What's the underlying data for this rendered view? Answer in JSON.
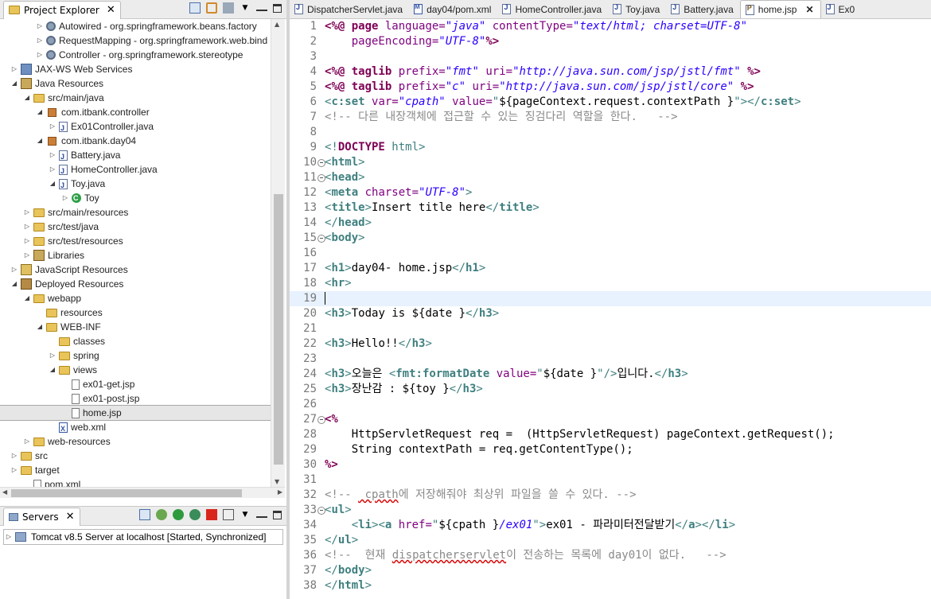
{
  "explorer": {
    "title": "Project Explorer",
    "close": "✕",
    "items": [
      {
        "indent": 3,
        "twisty": "▷",
        "icon": "gear",
        "label": "Autowired - org.springframework.beans.factory"
      },
      {
        "indent": 3,
        "twisty": "▷",
        "icon": "gear",
        "label": "RequestMapping - org.springframework.web.bind"
      },
      {
        "indent": 3,
        "twisty": "▷",
        "icon": "gear",
        "label": "Controller - org.springframework.stereotype"
      },
      {
        "indent": 1,
        "twisty": "▷",
        "icon": "jax",
        "label": "JAX-WS Web Services"
      },
      {
        "indent": 1,
        "twisty": "◢",
        "icon": "lib",
        "label": "Java Resources"
      },
      {
        "indent": 2,
        "twisty": "◢",
        "icon": "folder",
        "label": "src/main/java"
      },
      {
        "indent": 3,
        "twisty": "◢",
        "icon": "pkg",
        "label": "com.itbank.controller"
      },
      {
        "indent": 4,
        "twisty": "▷",
        "icon": "java",
        "label": "Ex01Controller.java"
      },
      {
        "indent": 3,
        "twisty": "◢",
        "icon": "pkg",
        "label": "com.itbank.day04"
      },
      {
        "indent": 4,
        "twisty": "▷",
        "icon": "java",
        "label": "Battery.java"
      },
      {
        "indent": 4,
        "twisty": "▷",
        "icon": "java",
        "label": "HomeController.java"
      },
      {
        "indent": 4,
        "twisty": "◢",
        "icon": "java",
        "label": "Toy.java"
      },
      {
        "indent": 5,
        "twisty": "▷",
        "icon": "cls",
        "label": "Toy"
      },
      {
        "indent": 2,
        "twisty": "▷",
        "icon": "folder",
        "label": "src/main/resources"
      },
      {
        "indent": 2,
        "twisty": "▷",
        "icon": "folder",
        "label": "src/test/java"
      },
      {
        "indent": 2,
        "twisty": "▷",
        "icon": "folder",
        "label": "src/test/resources"
      },
      {
        "indent": 2,
        "twisty": "▷",
        "icon": "lib",
        "label": "Libraries"
      },
      {
        "indent": 1,
        "twisty": "▷",
        "icon": "js",
        "label": "JavaScript Resources"
      },
      {
        "indent": 1,
        "twisty": "◢",
        "icon": "dep",
        "label": "Deployed Resources"
      },
      {
        "indent": 2,
        "twisty": "◢",
        "icon": "folder",
        "label": "webapp"
      },
      {
        "indent": 3,
        "twisty": "",
        "icon": "folder",
        "label": "resources"
      },
      {
        "indent": 3,
        "twisty": "◢",
        "icon": "folder",
        "label": "WEB-INF"
      },
      {
        "indent": 4,
        "twisty": "",
        "icon": "folder",
        "label": "classes"
      },
      {
        "indent": 4,
        "twisty": "▷",
        "icon": "folder",
        "label": "spring"
      },
      {
        "indent": 4,
        "twisty": "◢",
        "icon": "folder",
        "label": "views"
      },
      {
        "indent": 5,
        "twisty": "",
        "icon": "file",
        "label": "ex01-get.jsp"
      },
      {
        "indent": 5,
        "twisty": "",
        "icon": "file",
        "label": "ex01-post.jsp"
      },
      {
        "indent": 5,
        "twisty": "",
        "icon": "file",
        "label": "home.jsp",
        "selected": true
      },
      {
        "indent": 4,
        "twisty": "",
        "icon": "xml",
        "label": "web.xml"
      },
      {
        "indent": 2,
        "twisty": "▷",
        "icon": "folder",
        "label": "web-resources"
      },
      {
        "indent": 1,
        "twisty": "▷",
        "icon": "folder",
        "label": "src"
      },
      {
        "indent": 1,
        "twisty": "▷",
        "icon": "folder",
        "label": "target"
      },
      {
        "indent": 2,
        "twisty": "",
        "icon": "file",
        "label": "pom.xml"
      }
    ]
  },
  "servers": {
    "title": "Servers",
    "close": "✕",
    "row": "Tomcat v8.5 Server at localhost  [Started, Synchronized]"
  },
  "editor": {
    "tabs": [
      {
        "label": "DispatcherServlet.java",
        "icon": "j"
      },
      {
        "label": "day04/pom.xml",
        "icon": "m"
      },
      {
        "label": "HomeController.java",
        "icon": "j"
      },
      {
        "label": "Toy.java",
        "icon": "j"
      },
      {
        "label": "Battery.java",
        "icon": "j"
      },
      {
        "label": "home.jsp",
        "icon": "p",
        "active": true
      },
      {
        "label": "Ex0",
        "icon": "j"
      }
    ],
    "active_close": "✕",
    "current_line": 19,
    "colors": {
      "keyword": "#7f0055",
      "directive": "#7f0055",
      "string": "#2a00ff",
      "italic_string": "#2a00ff",
      "tag": "#3f7f7f",
      "tagname": "#3f7f7f",
      "attr": "#7f007f",
      "attrval": "#2a00ff",
      "comment": "#3f5fbf",
      "gray": "#8a8a8a",
      "el": "#000000",
      "text": "#000000"
    }
  },
  "code": [
    {
      "n": 1,
      "fold": false,
      "segs": [
        [
          "<%@ ",
          "d"
        ],
        [
          "page ",
          "k"
        ],
        [
          "language=",
          "a"
        ],
        [
          "\"java\"",
          "v"
        ],
        [
          " contentType=",
          "a"
        ],
        [
          "\"text/html; charset=UTF-8\"",
          "v"
        ]
      ]
    },
    {
      "n": 2,
      "fold": false,
      "segs": [
        [
          "    pageEncoding=",
          "a"
        ],
        [
          "\"UTF-8\"",
          "v"
        ],
        [
          "%>",
          "d"
        ]
      ]
    },
    {
      "n": 3,
      "fold": false,
      "segs": []
    },
    {
      "n": 4,
      "fold": false,
      "segs": [
        [
          "<%@ ",
          "d"
        ],
        [
          "taglib ",
          "k"
        ],
        [
          "prefix=",
          "a"
        ],
        [
          "\"fmt\"",
          "v"
        ],
        [
          " uri=",
          "a"
        ],
        [
          "\"http://java.sun.com/jsp/jstl/fmt\"",
          "v"
        ],
        [
          " %>",
          "d"
        ]
      ]
    },
    {
      "n": 5,
      "fold": false,
      "segs": [
        [
          "<%@ ",
          "d"
        ],
        [
          "taglib ",
          "k"
        ],
        [
          "prefix=",
          "a"
        ],
        [
          "\"c\"",
          "v"
        ],
        [
          " uri=",
          "a"
        ],
        [
          "\"http://java.sun.com/jsp/jstl/core\"",
          "v"
        ],
        [
          " %>",
          "d"
        ]
      ]
    },
    {
      "n": 6,
      "fold": false,
      "segs": [
        [
          "<",
          "t"
        ],
        [
          "c:set ",
          "tk"
        ],
        [
          "var=",
          "a"
        ],
        [
          "\"cpath\"",
          "v"
        ],
        [
          " value=",
          "a"
        ],
        [
          "\"",
          "t"
        ],
        [
          "${pageContext.request.contextPath }",
          "e"
        ],
        [
          "\"></",
          "t"
        ],
        [
          "c:set",
          "tk"
        ],
        [
          ">",
          "t"
        ]
      ]
    },
    {
      "n": 7,
      "fold": false,
      "segs": [
        [
          "<!-- ",
          "g"
        ],
        [
          "다른 내장객체에 접근할 수 있는 징검다리 역할을 한다.   -->",
          "g"
        ]
      ]
    },
    {
      "n": 8,
      "fold": false,
      "segs": []
    },
    {
      "n": 9,
      "fold": false,
      "segs": [
        [
          "<!",
          "t"
        ],
        [
          "DOCTYPE ",
          "dk"
        ],
        [
          "html",
          "h"
        ],
        [
          ">",
          "t"
        ]
      ]
    },
    {
      "n": 10,
      "fold": true,
      "segs": [
        [
          "<",
          "t"
        ],
        [
          "html",
          "tk"
        ],
        [
          ">",
          "t"
        ]
      ]
    },
    {
      "n": 11,
      "fold": true,
      "segs": [
        [
          "<",
          "t"
        ],
        [
          "head",
          "tk"
        ],
        [
          ">",
          "t"
        ]
      ]
    },
    {
      "n": 12,
      "fold": false,
      "segs": [
        [
          "<",
          "t"
        ],
        [
          "meta ",
          "tk"
        ],
        [
          "charset=",
          "a"
        ],
        [
          "\"UTF-8\"",
          "v"
        ],
        [
          ">",
          "t"
        ]
      ]
    },
    {
      "n": 13,
      "fold": false,
      "segs": [
        [
          "<",
          "t"
        ],
        [
          "title",
          "tk"
        ],
        [
          ">",
          "t"
        ],
        [
          "Insert title here",
          "x"
        ],
        [
          "</",
          "t"
        ],
        [
          "title",
          "tk"
        ],
        [
          ">",
          "t"
        ]
      ]
    },
    {
      "n": 14,
      "fold": false,
      "segs": [
        [
          "</",
          "t"
        ],
        [
          "head",
          "tk"
        ],
        [
          ">",
          "t"
        ]
      ]
    },
    {
      "n": 15,
      "fold": true,
      "segs": [
        [
          "<",
          "t"
        ],
        [
          "body",
          "tk"
        ],
        [
          ">",
          "t"
        ]
      ]
    },
    {
      "n": 16,
      "fold": false,
      "segs": []
    },
    {
      "n": 17,
      "fold": false,
      "segs": [
        [
          "<",
          "t"
        ],
        [
          "h1",
          "tk"
        ],
        [
          ">",
          "t"
        ],
        [
          "day04- home.jsp",
          "x"
        ],
        [
          "</",
          "t"
        ],
        [
          "h1",
          "tk"
        ],
        [
          ">",
          "t"
        ]
      ]
    },
    {
      "n": 18,
      "fold": false,
      "segs": [
        [
          "<",
          "t"
        ],
        [
          "hr",
          "tk"
        ],
        [
          ">",
          "t"
        ]
      ]
    },
    {
      "n": 19,
      "fold": false,
      "segs": []
    },
    {
      "n": 20,
      "fold": false,
      "segs": [
        [
          "<",
          "t"
        ],
        [
          "h3",
          "tk"
        ],
        [
          ">",
          "t"
        ],
        [
          "Today is ${date }",
          "x"
        ],
        [
          "</",
          "t"
        ],
        [
          "h3",
          "tk"
        ],
        [
          ">",
          "t"
        ]
      ]
    },
    {
      "n": 21,
      "fold": false,
      "segs": []
    },
    {
      "n": 22,
      "fold": false,
      "segs": [
        [
          "<",
          "t"
        ],
        [
          "h3",
          "tk"
        ],
        [
          ">",
          "t"
        ],
        [
          "Hello!!",
          "x"
        ],
        [
          "</",
          "t"
        ],
        [
          "h3",
          "tk"
        ],
        [
          ">",
          "t"
        ]
      ]
    },
    {
      "n": 23,
      "fold": false,
      "segs": []
    },
    {
      "n": 24,
      "fold": false,
      "segs": [
        [
          "<",
          "t"
        ],
        [
          "h3",
          "tk"
        ],
        [
          ">",
          "t"
        ],
        [
          "오늘은 ",
          "x"
        ],
        [
          "<",
          "t"
        ],
        [
          "fmt:formatDate ",
          "tk"
        ],
        [
          "value=",
          "a"
        ],
        [
          "\"",
          "t"
        ],
        [
          "${date }",
          "e"
        ],
        [
          "\"/>",
          "t"
        ],
        [
          "입니다.",
          "x"
        ],
        [
          "</",
          "t"
        ],
        [
          "h3",
          "tk"
        ],
        [
          ">",
          "t"
        ]
      ]
    },
    {
      "n": 25,
      "fold": false,
      "segs": [
        [
          "<",
          "t"
        ],
        [
          "h3",
          "tk"
        ],
        [
          ">",
          "t"
        ],
        [
          "장난감 : ${toy }",
          "x"
        ],
        [
          "</",
          "t"
        ],
        [
          "h3",
          "tk"
        ],
        [
          ">",
          "t"
        ]
      ]
    },
    {
      "n": 26,
      "fold": false,
      "segs": []
    },
    {
      "n": 27,
      "fold": true,
      "segs": [
        [
          "<%",
          "d"
        ]
      ]
    },
    {
      "n": 28,
      "fold": false,
      "segs": [
        [
          "    HttpServletRequest req =  (HttpServletRequest) pageContext.getRequest();",
          "x"
        ]
      ]
    },
    {
      "n": 29,
      "fold": false,
      "segs": [
        [
          "    String contextPath = req.getContentType();",
          "x"
        ]
      ]
    },
    {
      "n": 30,
      "fold": false,
      "segs": [
        [
          "%>",
          "d"
        ]
      ]
    },
    {
      "n": 31,
      "fold": false,
      "segs": []
    },
    {
      "n": 32,
      "fold": false,
      "segs": [
        [
          "<!-- ",
          "g"
        ],
        [
          " cpath",
          "gs"
        ],
        [
          "에 저장해줘야 최상위 파일을 쓸 수 있다. -->",
          "g"
        ]
      ]
    },
    {
      "n": 33,
      "fold": true,
      "segs": [
        [
          "<",
          "t"
        ],
        [
          "ul",
          "tk"
        ],
        [
          ">",
          "t"
        ]
      ]
    },
    {
      "n": 34,
      "fold": false,
      "segs": [
        [
          "    <",
          "t"
        ],
        [
          "li",
          "tk"
        ],
        [
          "><",
          "t"
        ],
        [
          "a ",
          "tk"
        ],
        [
          "href=",
          "a"
        ],
        [
          "\"",
          "t"
        ],
        [
          "${cpath }",
          "e"
        ],
        [
          "/ex01",
          "v"
        ],
        [
          "\">",
          "t"
        ],
        [
          "ex01 - 파라미터전달받기",
          "x"
        ],
        [
          "</",
          "t"
        ],
        [
          "a",
          "tk"
        ],
        [
          "></",
          "t"
        ],
        [
          "li",
          "tk"
        ],
        [
          ">",
          "t"
        ]
      ]
    },
    {
      "n": 35,
      "fold": false,
      "segs": [
        [
          "</",
          "t"
        ],
        [
          "ul",
          "tk"
        ],
        [
          ">",
          "t"
        ]
      ]
    },
    {
      "n": 36,
      "fold": false,
      "segs": [
        [
          "<!-- ",
          "g"
        ],
        [
          " 현재 ",
          "g"
        ],
        [
          "dispatcherservlet",
          "gs"
        ],
        [
          "이 전송하는 목록에 day01이 없다.   -->",
          "g"
        ]
      ]
    },
    {
      "n": 37,
      "fold": false,
      "segs": [
        [
          "</",
          "t"
        ],
        [
          "body",
          "tk"
        ],
        [
          ">",
          "t"
        ]
      ]
    },
    {
      "n": 38,
      "fold": false,
      "segs": [
        [
          "</",
          "t"
        ],
        [
          "html",
          "tk"
        ],
        [
          ">",
          "t"
        ]
      ]
    }
  ]
}
